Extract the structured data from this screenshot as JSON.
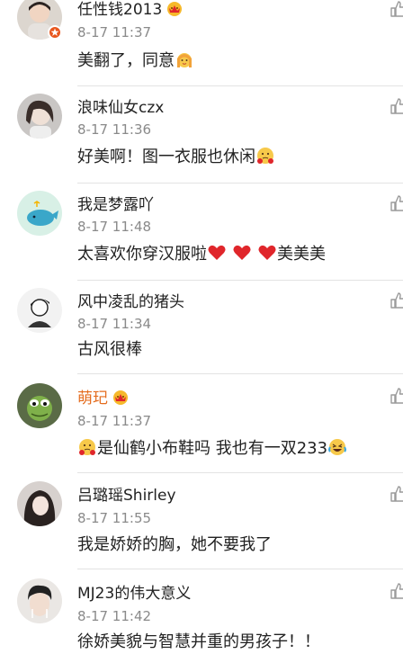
{
  "comments": [
    {
      "name": "任性钱2013",
      "time": "8-17 11:37",
      "text": "美翻了，同意",
      "emoji": "blonde-woman-emoji",
      "badge": "crown-icon",
      "verified": "verified-badge-icon"
    },
    {
      "name": "浪味仙女czx",
      "time": "8-17 11:36",
      "text": "好美啊！图一衣服也休闲",
      "emoji": "thinking-face-emoji"
    },
    {
      "name": "我是梦露吖",
      "time": "8-17 11:48",
      "text": "太喜欢你穿汉服啦",
      "hearts": "red-heart-emoji",
      "text_after": "美美美"
    },
    {
      "name": "风中凌乱的猪头",
      "time": "8-17 11:34",
      "text": "古风很棒"
    },
    {
      "name": "萌玘",
      "time": "8-17 11:37",
      "text": "是仙鹤小布鞋吗 我也有一双233",
      "emoji_before": "thinking-face-emoji",
      "emoji": "laughing-tears-emoji",
      "badge": "crown-icon",
      "name_color": "#e46c1e"
    },
    {
      "name": "吕璐瑶Shirley",
      "time": "8-17 11:55",
      "text": "我是娇娇的胸，她不要我了"
    },
    {
      "name": "MJ23的伟大意义",
      "time": "8-17 11:42",
      "text": "徐娇美貌与智慧并重的男孩子！！"
    }
  ],
  "colors": {
    "name": "#222222",
    "time": "#8a8a8a",
    "vip_name": "#e46c1e",
    "divider": "#e3e3e3",
    "heart": "#e0262b"
  },
  "icons": {
    "like": "thumbs-up-icon"
  }
}
